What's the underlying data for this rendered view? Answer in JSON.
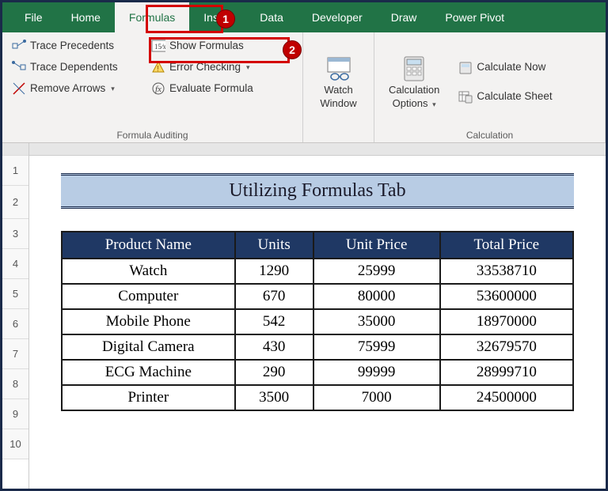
{
  "tabs": [
    "File",
    "Home",
    "Formulas",
    "Insert",
    "Data",
    "Developer",
    "Draw",
    "Power Pivot"
  ],
  "active_tab_index": 2,
  "callouts": {
    "formulas_tab": "1",
    "show_formulas": "2"
  },
  "ribbon": {
    "auditing": {
      "trace_precedents": "Trace Precedents",
      "trace_dependents": "Trace Dependents",
      "remove_arrows": "Remove Arrows",
      "show_formulas": "Show Formulas",
      "error_checking": "Error Checking",
      "evaluate_formula": "Evaluate Formula",
      "group_label": "Formula Auditing"
    },
    "watch": {
      "label_line1": "Watch",
      "label_line2": "Window"
    },
    "calc": {
      "options_line1": "Calculation",
      "options_line2": "Options",
      "calc_now": "Calculate Now",
      "calc_sheet": "Calculate Sheet",
      "group_label": "Calculation"
    }
  },
  "row_numbers": [
    "1",
    "2",
    "3",
    "4",
    "5",
    "6",
    "7",
    "8",
    "9",
    "10"
  ],
  "title": "Utilizing Formulas Tab",
  "table": {
    "headers": [
      "Product Name",
      "Units",
      "Unit Price",
      "Total Price"
    ],
    "rows": [
      [
        "Watch",
        "1290",
        "25999",
        "33538710"
      ],
      [
        "Computer",
        "670",
        "80000",
        "53600000"
      ],
      [
        "Mobile Phone",
        "542",
        "35000",
        "18970000"
      ],
      [
        "Digital Camera",
        "430",
        "75999",
        "32679570"
      ],
      [
        "ECG Machine",
        "290",
        "99999",
        "28999710"
      ],
      [
        "Printer",
        "3500",
        "7000",
        "24500000"
      ]
    ]
  }
}
